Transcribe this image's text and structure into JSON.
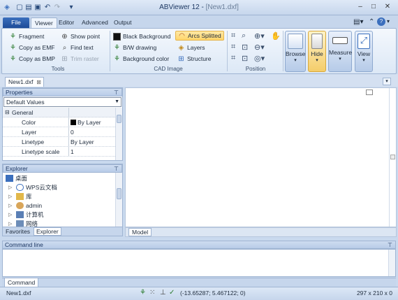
{
  "window": {
    "app_title": "ABViewer 12",
    "doc_title": "[New1.dxf]"
  },
  "tabs": [
    {
      "label": "File"
    },
    {
      "label": "Viewer"
    },
    {
      "label": "Editor"
    },
    {
      "label": "Advanced"
    },
    {
      "label": "Output"
    }
  ],
  "ribbon": {
    "tools": {
      "group_label": "Tools",
      "fragment": "Fragment",
      "copy_emf": "Copy as EMF",
      "copy_bmp": "Copy as BMP",
      "show_point": "Show point",
      "find_text": "Find text",
      "trim_raster": "Trim raster"
    },
    "cad_image": {
      "group_label": "CAD Image",
      "black_background": "Black Background",
      "bw_drawing": "B/W drawing",
      "background_color": "Background color",
      "arcs_splitted": "Arcs Splitted",
      "layers": "Layers",
      "structure": "Structure"
    },
    "position": {
      "group_label": "Position"
    },
    "browse": "Browse",
    "hide": "Hide",
    "measure": "Measure",
    "view": "View"
  },
  "document_tab": "New1.dxf",
  "properties": {
    "title": "Properties",
    "selector_value": "Default Values",
    "section": "General",
    "rows": [
      {
        "key": "Color",
        "value": "By Layer"
      },
      {
        "key": "Layer",
        "value": "0"
      },
      {
        "key": "Linetype",
        "value": "By Layer"
      },
      {
        "key": "Linetype scale",
        "value": "1"
      }
    ]
  },
  "explorer": {
    "title": "Explorer",
    "items": [
      {
        "label": "桌面"
      },
      {
        "label": "WPS云文档"
      },
      {
        "label": "库"
      },
      {
        "label": "admin"
      },
      {
        "label": "计算机"
      },
      {
        "label": "网络"
      }
    ],
    "bottom_tabs": [
      {
        "label": "Favorites"
      },
      {
        "label": "Explorer"
      }
    ]
  },
  "canvas": {
    "model_tab": "Model"
  },
  "command_line": {
    "title": "Command line",
    "tab": "Command"
  },
  "status_bar": {
    "file": "New1.dxf",
    "coordinates": "(-13.65287; 5.467122; 0)",
    "size": "297 x 210 x 0"
  },
  "colors": {
    "accent": "#1e4c98",
    "ribbon_bg": "#dce8f6",
    "highlight": "#ffd56b"
  }
}
